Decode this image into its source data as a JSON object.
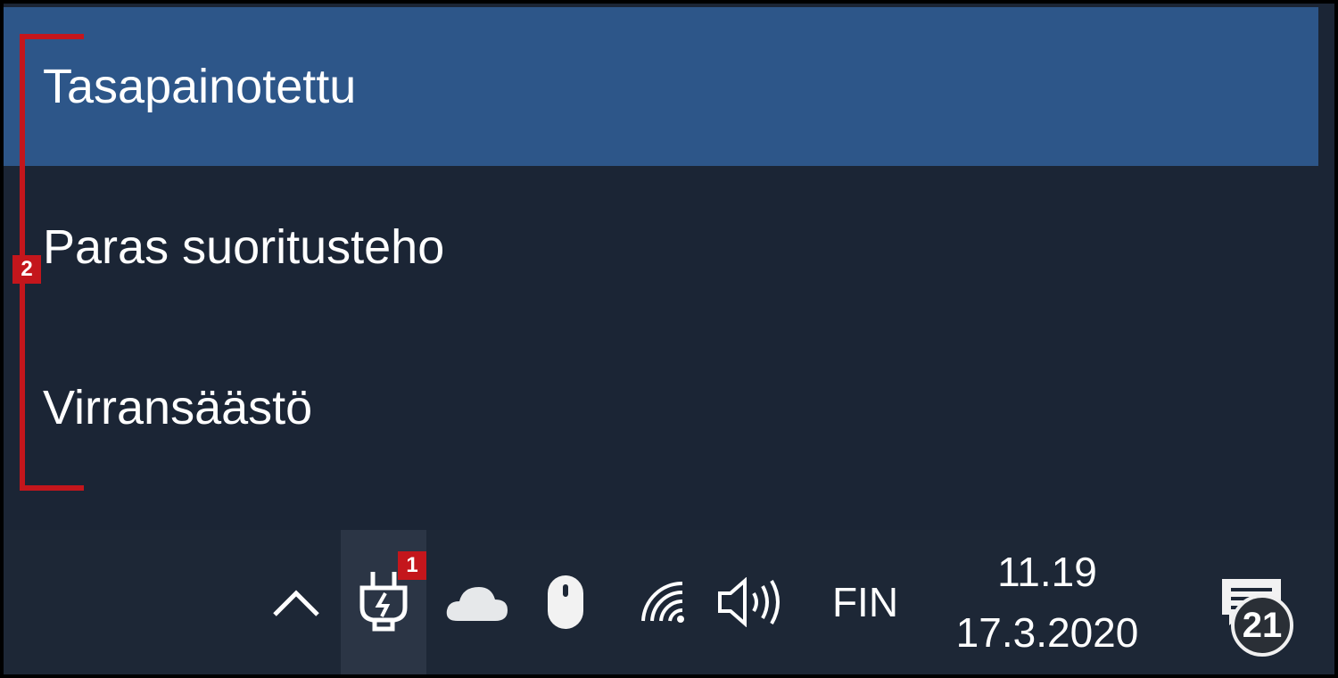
{
  "power_menu": {
    "items": [
      {
        "label": "Tasapainotettu",
        "selected": true
      },
      {
        "label": "Paras suoritusteho",
        "selected": false
      },
      {
        "label": "Virransäästö",
        "selected": false
      }
    ]
  },
  "annotations": {
    "callout_1": "1",
    "callout_2": "2"
  },
  "taskbar": {
    "icons": [
      "chevron-up-icon",
      "power-plug-icon",
      "onedrive-cloud-icon",
      "mouse-icon",
      "wifi-icon",
      "volume-icon",
      "action-center-icon"
    ],
    "language": "FIN",
    "time": "11.19",
    "date": "17.3.2020",
    "notification_count": "21"
  },
  "colors": {
    "background": "#1b2535",
    "selected": "#2d5689",
    "annotation_red": "#c4161c"
  }
}
